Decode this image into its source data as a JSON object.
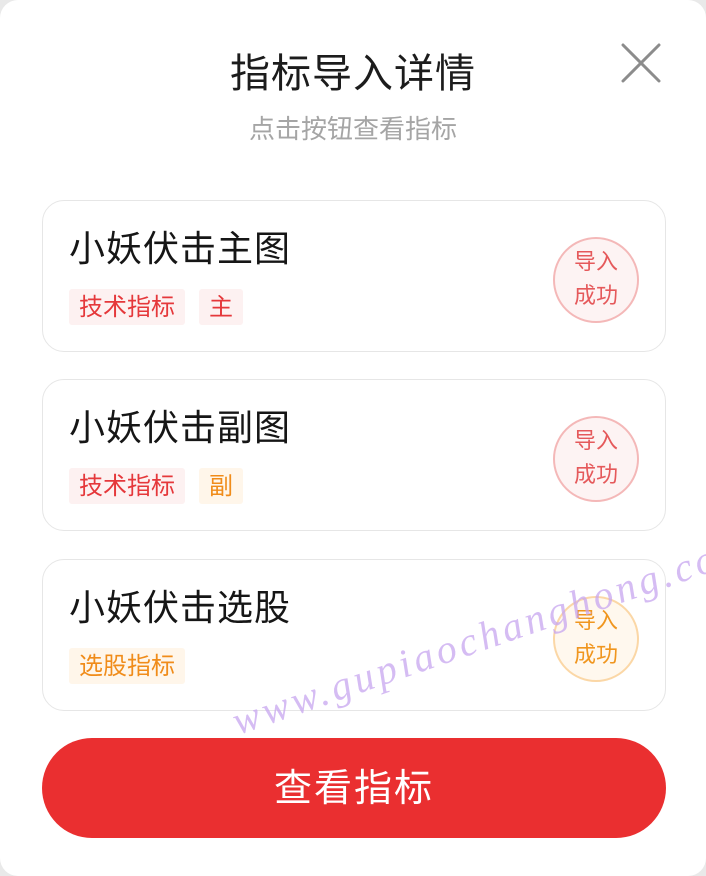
{
  "dialog": {
    "title": "指标导入详情",
    "subtitle": "点击按钮查看指标",
    "close_icon": "close-icon"
  },
  "cards": [
    {
      "title": "小妖伏击主图",
      "tags": [
        {
          "label": "技术指标",
          "color": "#e5383b"
        },
        {
          "label": "主",
          "color": "#e5383b"
        }
      ],
      "status_line1": "导入",
      "status_line2": "成功",
      "status_color": "#e5595b"
    },
    {
      "title": "小妖伏击副图",
      "tags": [
        {
          "label": "技术指标",
          "color": "#e5383b"
        },
        {
          "label": "副",
          "color": "#f08c1a"
        }
      ],
      "status_line1": "导入",
      "status_line2": "成功",
      "status_color": "#e5595b"
    },
    {
      "title": "小妖伏击选股",
      "tags": [
        {
          "label": "选股指标",
          "color": "#f08c1a"
        }
      ],
      "status_line1": "导入",
      "status_line2": "成功",
      "status_color": "#f0961f"
    }
  ],
  "primary_button": {
    "label": "查看指标",
    "color": "#ea2f30"
  },
  "watermark": "www.gupiaochanghong.com"
}
